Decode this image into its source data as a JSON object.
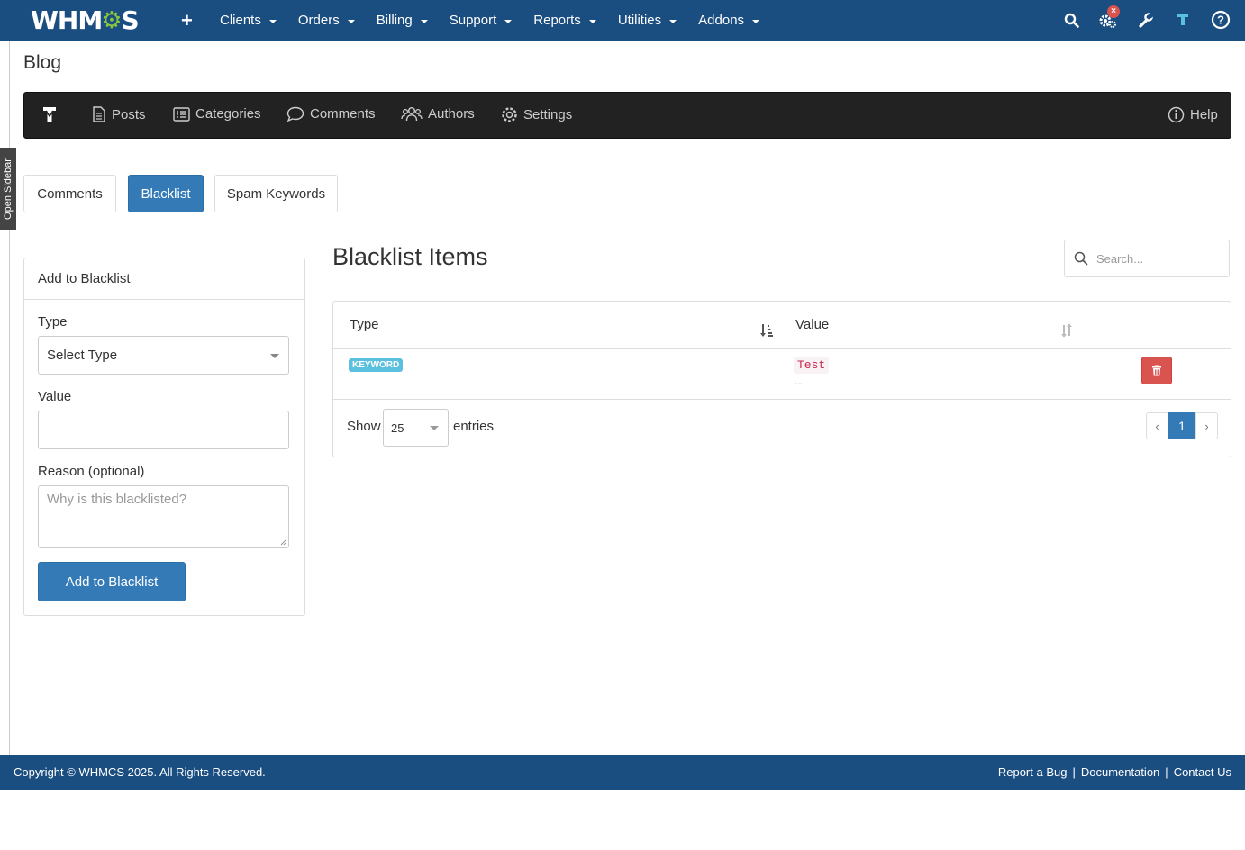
{
  "topbar": {
    "logo_prefix": "WHM",
    "logo_suffix": "S",
    "menu": [
      {
        "label": "Clients"
      },
      {
        "label": "Orders"
      },
      {
        "label": "Billing"
      },
      {
        "label": "Support"
      },
      {
        "label": "Reports"
      },
      {
        "label": "Utilities"
      },
      {
        "label": "Addons"
      }
    ],
    "icons": [
      "plus-icon",
      "search-icon",
      "automation-gear-icon",
      "wrench-icon",
      "blog-module-icon",
      "help-icon"
    ],
    "badge": "×"
  },
  "sidebar_toggle": "Open Sidebar",
  "page": {
    "title": "Blog"
  },
  "blog_nav": {
    "items": [
      {
        "label": "Posts"
      },
      {
        "label": "Categories"
      },
      {
        "label": "Comments"
      },
      {
        "label": "Authors"
      },
      {
        "label": "Settings"
      }
    ],
    "help": "Help"
  },
  "tabs": [
    {
      "label": "Comments"
    },
    {
      "label": "Blacklist"
    },
    {
      "label": "Spam Keywords"
    }
  ],
  "add_panel": {
    "heading": "Add to Blacklist",
    "type_label": "Type",
    "type_value": "Select Type",
    "value_label": "Value",
    "value_value": "",
    "reason_label": "Reason (optional)",
    "reason_placeholder": "Why is this blacklisted?",
    "submit": "Add to Blacklist"
  },
  "list": {
    "title": "Blacklist Items",
    "search_placeholder": "Search...",
    "columns": [
      "Type",
      "Value"
    ],
    "rows": [
      {
        "type": "KEYWORD",
        "value": "Test",
        "reason": "--"
      }
    ],
    "show_label": "Show",
    "page_length": "25",
    "entries_label": "entries",
    "pagination": {
      "prev": "‹",
      "current": "1",
      "next": "›"
    }
  },
  "footer": {
    "copyright": "Copyright © WHMCS 2025. All Rights Reserved.",
    "links": [
      "Report a Bug",
      "Documentation",
      "Contact Us"
    ],
    "separator": "|"
  },
  "colors": {
    "navbar": "#1a4d80",
    "primary": "#337ab7",
    "danger": "#d9534f",
    "info": "#5bc0de",
    "blog_nav": "#222222"
  }
}
